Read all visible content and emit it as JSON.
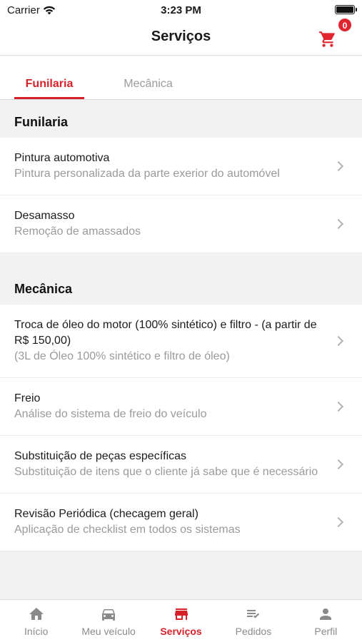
{
  "status_bar": {
    "carrier": "Carrier",
    "time": "3:23 PM"
  },
  "nav": {
    "title": "Serviços",
    "cart_count": "0"
  },
  "tabs": [
    {
      "label": "Funilaria"
    },
    {
      "label": "Mecânica"
    }
  ],
  "sections": [
    {
      "title": "Funilaria",
      "items": [
        {
          "title": "Pintura automotiva",
          "description": "Pintura personalizada da parte exerior do automóvel"
        },
        {
          "title": "Desamasso",
          "description": "Remoção de amassados"
        }
      ]
    },
    {
      "title": "Mecânica",
      "items": [
        {
          "title": "Troca de óleo do motor (100% sintético)  e filtro - (a partir de R$ 150,00)",
          "description": "(3L de Óleo 100% sintético e filtro de óleo)"
        },
        {
          "title": "Freio",
          "description": "Análise do sistema de freio do veículo"
        },
        {
          "title": "Substituição de peças específicas",
          "description": "Substituição de itens que o cliente já sabe que é necessário"
        },
        {
          "title": "Revisão Periódica (checagem geral)",
          "description": "Aplicação de checklist em todos os sistemas"
        }
      ]
    }
  ],
  "tab_bar": [
    {
      "label": "Início",
      "icon": "home-icon"
    },
    {
      "label": "Meu veículo",
      "icon": "car-icon"
    },
    {
      "label": "Serviços",
      "icon": "store-icon"
    },
    {
      "label": "Pedidos",
      "icon": "checklist-icon"
    },
    {
      "label": "Perfil",
      "icon": "person-icon"
    }
  ],
  "colors": {
    "accent": "#d6202a",
    "muted": "#9a9a9a",
    "background": "#f2f2f2"
  }
}
